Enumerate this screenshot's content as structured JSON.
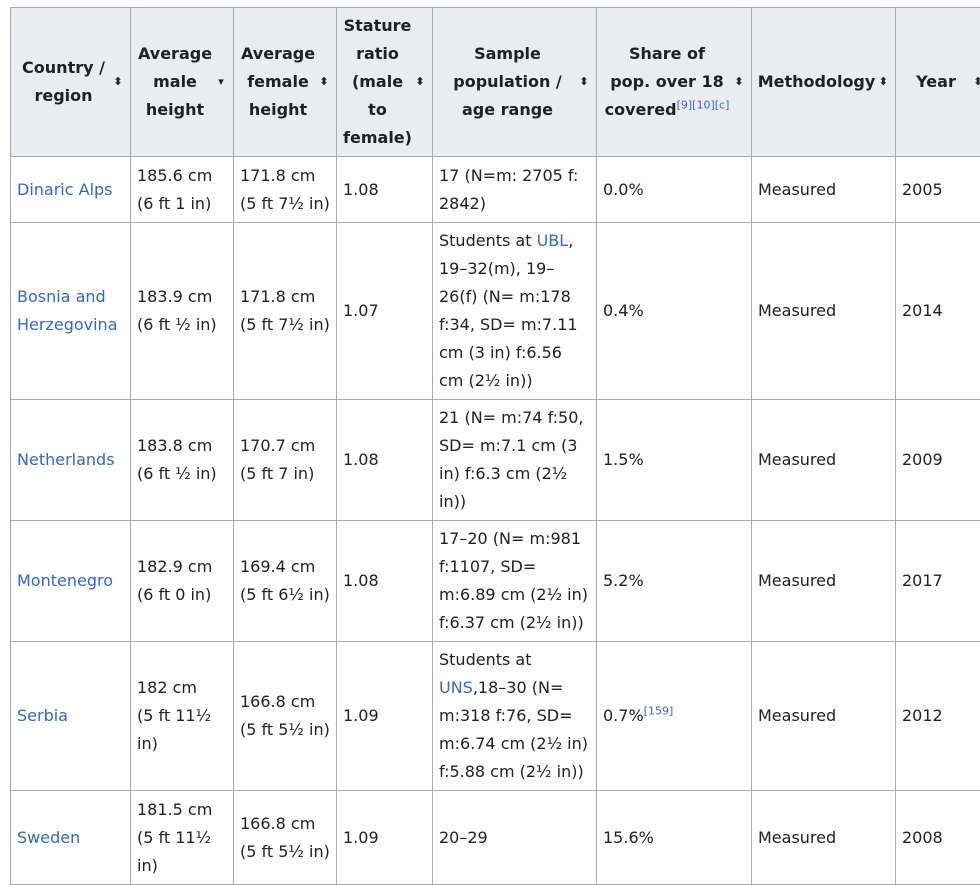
{
  "headers": {
    "country": "Country / region",
    "male_1": "Average",
    "male_2": "male",
    "male_3": "height",
    "female_1": "Average",
    "female_2": "female",
    "female_3": "height",
    "ratio_1": "Stature",
    "ratio_2": "ratio",
    "ratio_3": "(male",
    "ratio_4": "to",
    "ratio_5": "female)",
    "sample_1": "Sample",
    "sample_2": "population /",
    "sample_3": "age range",
    "share_1": "Share of",
    "share_2": "pop. over 18",
    "share_3": "covered",
    "share_refs": "[9][10][c]",
    "method": "Methodology",
    "year": "Year"
  },
  "sort_icons": {
    "default": "sort-both-icon",
    "male": "sort-down-icon"
  },
  "rows": [
    {
      "country": "Dinaric Alps",
      "male_cm": "185.6 cm",
      "male_ft": "(6 ft 1 in)",
      "female_cm": "171.8 cm",
      "female_ft": "(5 ft 7½ in)",
      "ratio": "1.08",
      "sample": "17 (N=m: 2705 f: 2842)",
      "share": "0.0%",
      "method": "Measured",
      "year": "2005"
    },
    {
      "country": "Bosnia and Herzegovina",
      "male_cm": "183.9 cm",
      "male_ft": "(6 ft ½ in)",
      "female_cm": "171.8 cm",
      "female_ft": "(5 ft 7½ in)",
      "ratio": "1.07",
      "sample_prefix": "Students at ",
      "sample_link": "UBL",
      "sample_suffix": ", 19–32(m), 19–26(f) (N= m:178 f:34, SD= m:7.11 cm (3 in) f:6.56 cm (2½ in))",
      "share": "0.4%",
      "method": "Measured",
      "year": "2014"
    },
    {
      "country": "Netherlands",
      "male_cm": "183.8 cm",
      "male_ft": "(6 ft ½ in)",
      "female_cm": "170.7 cm",
      "female_ft": "(5 ft 7 in)",
      "ratio": "1.08",
      "sample": "21 (N= m:74 f:50, SD= m:7.1 cm (3 in) f:6.3 cm (2½ in))",
      "share": "1.5%",
      "method": "Measured",
      "year": "2009"
    },
    {
      "country": "Montenegro",
      "male_cm": "182.9 cm",
      "male_ft": "(6 ft 0 in)",
      "female_cm": "169.4 cm",
      "female_ft": "(5 ft 6½ in)",
      "ratio": "1.08",
      "sample": "17–20 (N= m:981 f:1107, SD= m:6.89 cm (2½ in) f:6.37 cm (2½ in))",
      "share": "5.2%",
      "method": "Measured",
      "year": "2017"
    },
    {
      "country": "Serbia",
      "male_cm": "182 cm",
      "male_ft": "(5 ft 11½ in)",
      "female_cm": "166.8 cm",
      "female_ft": "(5 ft 5½ in)",
      "ratio": "1.09",
      "sample_prefix": "Students at ",
      "sample_link": "UNS",
      "sample_suffix": ",18–30 (N= m:318 f:76, SD= m:6.74 cm (2½ in) f:5.88 cm (2½ in))",
      "share": "0.7%",
      "share_ref": "[159]",
      "method": "Measured",
      "year": "2012"
    },
    {
      "country": "Sweden",
      "male_cm": "181.5 cm",
      "male_ft": "(5 ft 11½ in)",
      "female_cm": "166.8 cm",
      "female_ft": "(5 ft 5½ in)",
      "ratio": "1.09",
      "sample": "20–29",
      "share": "15.6%",
      "method": "Measured",
      "year": "2008"
    }
  ]
}
